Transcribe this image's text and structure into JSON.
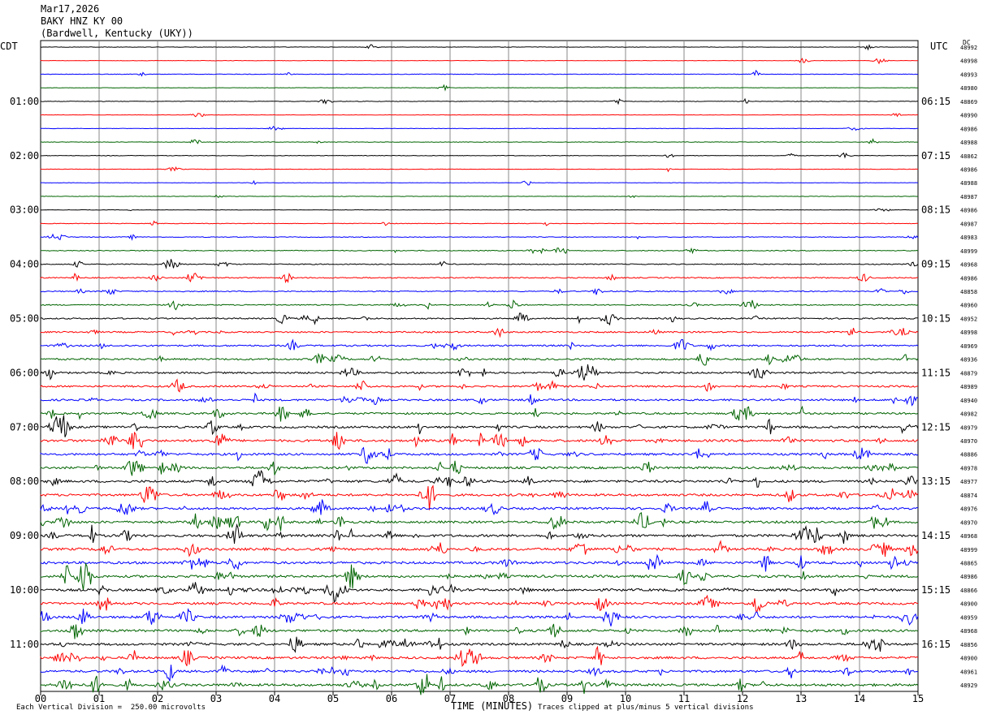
{
  "header": {
    "date": "Mar17,2026",
    "station": "BAKY HNZ KY 00",
    "location": "(Bardwell, Kentucky (UKY))"
  },
  "axes": {
    "left_tz": "CDT",
    "right_tz": "UTC",
    "dc_label": "DC",
    "xlabel": "TIME (MINUTES)",
    "scale_note": "Each Vertical Division =  250.00 microvolts",
    "clip_note": "Traces clipped at plus/minus 5 vertical divisions"
  },
  "chart_data": {
    "type": "line",
    "title": "",
    "xlabel": "TIME (MINUTES)",
    "xlim": [
      0,
      15
    ],
    "x_ticks": [
      "00",
      "01",
      "02",
      "03",
      "04",
      "05",
      "06",
      "07",
      "08",
      "09",
      "10",
      "11",
      "12",
      "13",
      "14",
      "15"
    ],
    "trace_count": 48,
    "minutes_per_trace": 15,
    "trace_colors": [
      "#000000",
      "#ff0000",
      "#0000ff",
      "#006400"
    ],
    "left_labels": [
      {
        "trace": 4,
        "text": "01:00"
      },
      {
        "trace": 8,
        "text": "02:00"
      },
      {
        "trace": 12,
        "text": "03:00"
      },
      {
        "trace": 16,
        "text": "04:00"
      },
      {
        "trace": 20,
        "text": "05:00"
      },
      {
        "trace": 24,
        "text": "06:00"
      },
      {
        "trace": 28,
        "text": "07:00"
      },
      {
        "trace": 32,
        "text": "08:00"
      },
      {
        "trace": 36,
        "text": "09:00"
      },
      {
        "trace": 40,
        "text": "10:00"
      },
      {
        "trace": 44,
        "text": "11:00"
      }
    ],
    "right_labels": [
      {
        "trace": 4,
        "text": "06:15"
      },
      {
        "trace": 8,
        "text": "07:15"
      },
      {
        "trace": 12,
        "text": "08:15"
      },
      {
        "trace": 16,
        "text": "09:15"
      },
      {
        "trace": 20,
        "text": "10:15"
      },
      {
        "trace": 24,
        "text": "11:15"
      },
      {
        "trace": 28,
        "text": "12:15"
      },
      {
        "trace": 32,
        "text": "13:15"
      },
      {
        "trace": 36,
        "text": "14:15"
      },
      {
        "trace": 40,
        "text": "15:15"
      },
      {
        "trace": 44,
        "text": "16:15"
      }
    ],
    "dc_values": [
      "48992",
      "48998",
      "48993",
      "48980",
      "48869",
      "48990",
      "48986",
      "48988",
      "48862",
      "48986",
      "48988",
      "48987",
      "48986",
      "48987",
      "48983",
      "48999",
      "48968",
      "48986",
      "48858",
      "48960",
      "48952",
      "48998",
      "48969",
      "48936",
      "48879",
      "48989",
      "48940",
      "48982",
      "48979",
      "48970",
      "48886",
      "48978",
      "48977",
      "48874",
      "48976",
      "48970",
      "48968",
      "48999",
      "48865",
      "48986",
      "48866",
      "48900",
      "48959",
      "48968",
      "48856",
      "48900",
      "48961",
      "48929"
    ],
    "activity": [
      0.15,
      0.15,
      0.2,
      0.15,
      0.2,
      0.15,
      0.15,
      0.2,
      0.2,
      0.15,
      0.15,
      0.15,
      0.15,
      0.2,
      0.25,
      0.3,
      0.35,
      0.4,
      0.4,
      0.4,
      0.5,
      0.55,
      0.6,
      0.65,
      0.65,
      0.65,
      0.7,
      0.7,
      0.8,
      0.85,
      0.8,
      0.8,
      0.85,
      0.85,
      0.85,
      0.85,
      0.9,
      0.9,
      0.9,
      0.9,
      0.9,
      0.85,
      0.85,
      0.85,
      0.85,
      0.85,
      0.85,
      0.9
    ]
  }
}
